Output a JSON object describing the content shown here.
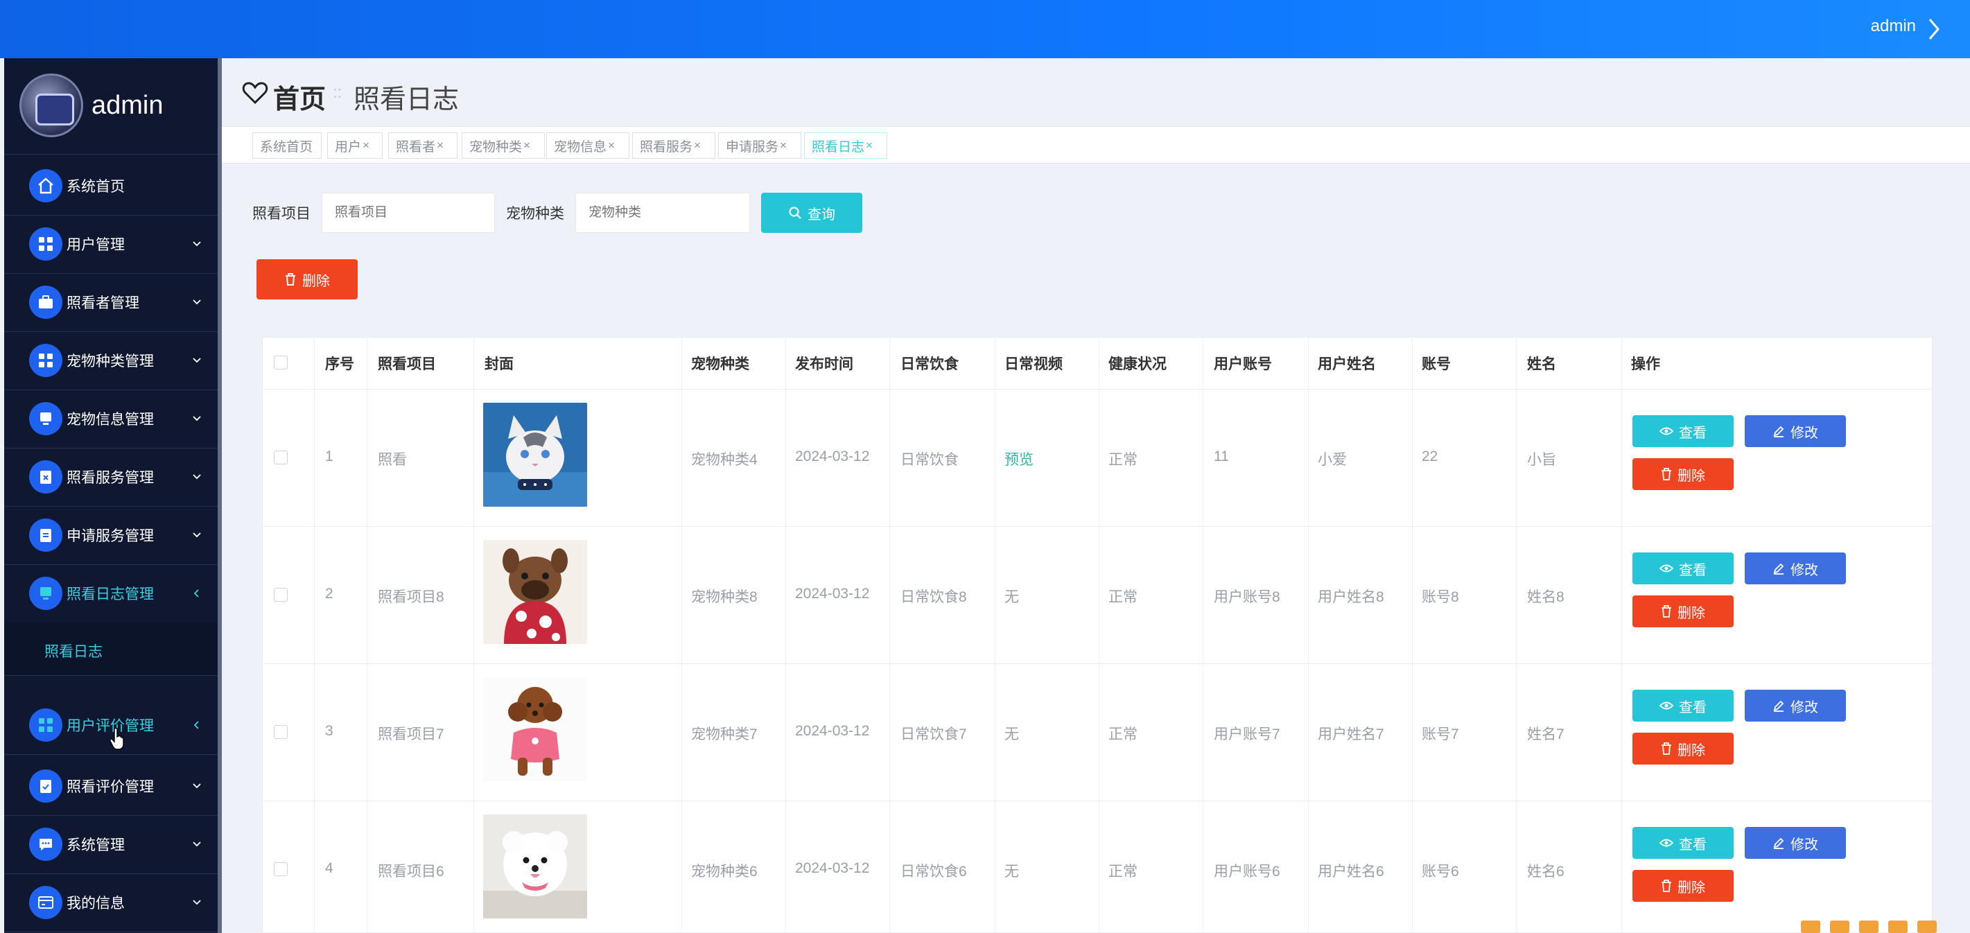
{
  "topbar": {
    "user": "admin"
  },
  "sidebar": {
    "brand": "admin",
    "items": [
      {
        "label": "系统首页",
        "icon": "home-icon"
      },
      {
        "label": "用户管理",
        "icon": "grid-icon"
      },
      {
        "label": "照看者管理",
        "icon": "briefcase-icon"
      },
      {
        "label": "宠物种类管理",
        "icon": "grid-icon"
      },
      {
        "label": "宠物信息管理",
        "icon": "monitor-icon"
      },
      {
        "label": "照看服务管理",
        "icon": "clipboard-x-icon"
      },
      {
        "label": "申请服务管理",
        "icon": "clipboard-icon"
      },
      {
        "label": "照看日志管理",
        "icon": "monitor-icon"
      },
      {
        "label": "用户评价管理",
        "icon": "grid-icon"
      },
      {
        "label": "照看评价管理",
        "icon": "clipboard-check-icon"
      },
      {
        "label": "系统管理",
        "icon": "chat-icon"
      },
      {
        "label": "我的信息",
        "icon": "card-icon"
      }
    ],
    "sub_item": "照看日志"
  },
  "header": {
    "home": "首页",
    "separator": "::",
    "current": "照看日志"
  },
  "tabs": [
    {
      "label": "系统首页",
      "closable": false
    },
    {
      "label": "用户",
      "closable": true
    },
    {
      "label": "照看者",
      "closable": true
    },
    {
      "label": "宠物种类",
      "closable": true
    },
    {
      "label": "宠物信息",
      "closable": true
    },
    {
      "label": "照看服务",
      "closable": true
    },
    {
      "label": "申请服务",
      "closable": true
    },
    {
      "label": "照看日志",
      "closable": true,
      "active": true
    }
  ],
  "tab_close": "×",
  "search": {
    "project_label": "照看项目",
    "project_placeholder": "照看项目",
    "species_label": "宠物种类",
    "species_placeholder": "宠物种类",
    "query_button": "查询"
  },
  "delete_button": "删除",
  "table": {
    "columns": [
      "序号",
      "照看项目",
      "封面",
      "宠物种类",
      "发布时间",
      "日常饮食",
      "日常视频",
      "健康状况",
      "用户账号",
      "用户姓名",
      "账号",
      "姓名",
      "操作"
    ],
    "rows": [
      {
        "index": "1",
        "project": "照看",
        "cover": "white-cat",
        "species": "宠物种类4",
        "time": "2024-03-12",
        "diet": "日常饮食",
        "video": "预览",
        "health": "正常",
        "user_account": "11",
        "user_name": "小爱",
        "account": "22",
        "name": "小旨"
      },
      {
        "index": "2",
        "project": "照看项目8",
        "cover": "french-bulldog",
        "species": "宠物种类8",
        "time": "2024-03-12",
        "diet": "日常饮食8",
        "video": "无",
        "health": "正常",
        "user_account": "用户账号8",
        "user_name": "用户姓名8",
        "account": "账号8",
        "name": "姓名8"
      },
      {
        "index": "3",
        "project": "照看项目7",
        "cover": "poodle",
        "species": "宠物种类7",
        "time": "2024-03-12",
        "diet": "日常饮食7",
        "video": "无",
        "health": "正常",
        "user_account": "用户账号7",
        "user_name": "用户姓名7",
        "account": "账号7",
        "name": "姓名7"
      },
      {
        "index": "4",
        "project": "照看项目6",
        "cover": "white-pomeranian",
        "species": "宠物种类6",
        "time": "2024-03-12",
        "diet": "日常饮食6",
        "video": "无",
        "health": "正常",
        "user_account": "用户账号6",
        "user_name": "用户姓名6",
        "account": "账号6",
        "name": "姓名6"
      }
    ],
    "actions": {
      "view": "查看",
      "edit": "修改",
      "delete": "删除"
    }
  },
  "colors": {
    "accent": "#25c4d6",
    "danger": "#f0431f",
    "primary": "#3d6fe0",
    "sidebar": "#0f1830",
    "topbar": "#0f78ff"
  }
}
